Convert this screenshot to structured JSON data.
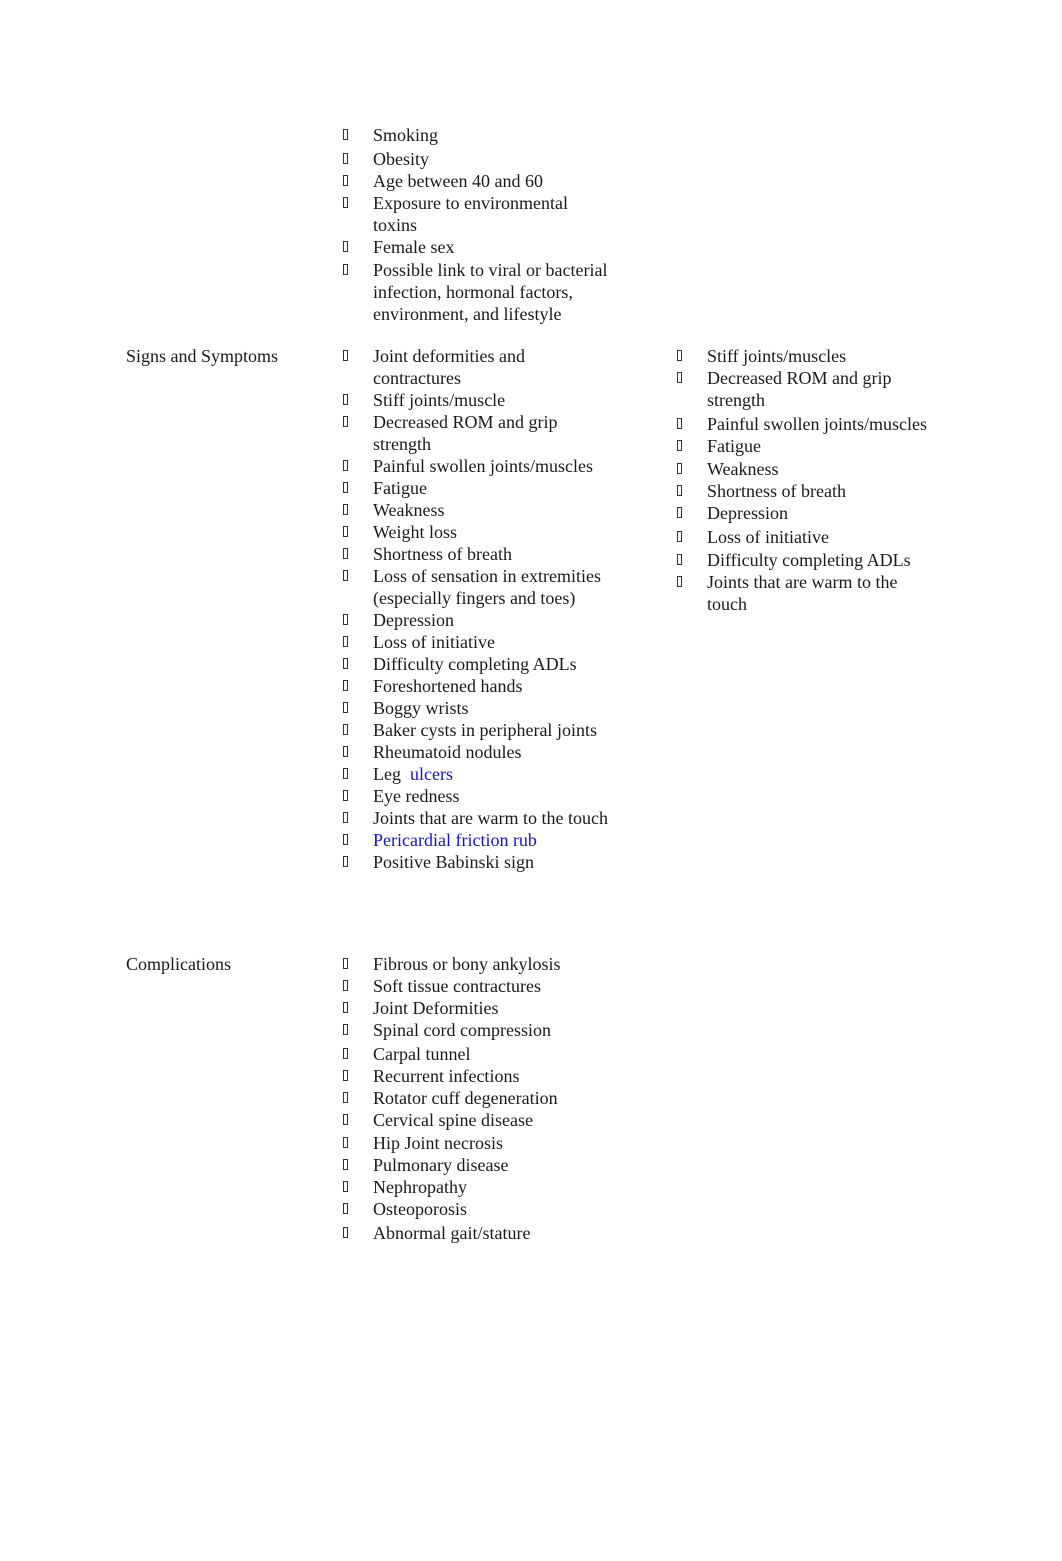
{
  "risk_factors": {
    "label": "",
    "items": [
      {
        "text": "Smoking"
      },
      {
        "text": "Obesity"
      },
      {
        "text": "Age between 40 and 60"
      },
      {
        "text": "Exposure to environmental toxins"
      },
      {
        "text": "Female sex"
      },
      {
        "text": "Possible link to viral or bacterial infection, hormonal factors, environment, and lifestyle"
      }
    ]
  },
  "signs_and_symptoms": {
    "label": "Signs and Symptoms",
    "items": [
      {
        "text": "Joint deformities and contractures"
      },
      {
        "text": "Stiff joints/muscle"
      },
      {
        "text": "Decreased ROM and grip strength"
      },
      {
        "text": "Painful swollen joints/muscles"
      },
      {
        "text": "Fatigue"
      },
      {
        "text": "Weakness"
      },
      {
        "text": "Weight loss"
      },
      {
        "text": "Shortness of breath"
      },
      {
        "text": "Loss of sensation in extremities (especially fingers and toes)"
      },
      {
        "text": "Depression"
      },
      {
        "text": "Loss of initiative"
      },
      {
        "text": "Difficulty completing ADLs"
      },
      {
        "text": "Foreshortened hands"
      },
      {
        "text": "Boggy wrists"
      },
      {
        "text": "Baker cysts in peripheral joints"
      },
      {
        "text": "Rheumatoid nodules"
      },
      {
        "text": "Leg",
        "link": "ulcers"
      },
      {
        "text": "Eye redness"
      },
      {
        "text": "Joints that are warm to the touch"
      },
      {
        "text": "",
        "link": "Pericardial friction rub"
      },
      {
        "text": "Positive Babinski sign"
      }
    ],
    "patient_items": [
      {
        "text": "Stiff joints/muscles"
      },
      {
        "text": "Decreased ROM and grip strength"
      },
      {
        "text": "Painful swollen joints/muscles"
      },
      {
        "text": "Fatigue"
      },
      {
        "text": "Weakness"
      },
      {
        "text": "Shortness of breath"
      },
      {
        "text": "Depression"
      },
      {
        "text": "Loss of initiative"
      },
      {
        "text": "Difficulty completing ADLs"
      },
      {
        "text": "Joints that are warm to the touch"
      }
    ]
  },
  "complications": {
    "label": "Complications",
    "items": [
      {
        "text": "Fibrous or bony ankylosis"
      },
      {
        "text": "Soft tissue contractures"
      },
      {
        "text": "Joint Deformities"
      },
      {
        "text": "Spinal cord compression"
      },
      {
        "text": "Carpal tunnel"
      },
      {
        "text": "Recurrent infections"
      },
      {
        "text": "Rotator cuff degeneration"
      },
      {
        "text": "Cervical spine disease"
      },
      {
        "text": "Hip Joint necrosis"
      },
      {
        "text": "Pulmonary disease"
      },
      {
        "text": "Nephropathy"
      },
      {
        "text": "Osteoporosis"
      },
      {
        "text": "Abnormal gait/stature"
      }
    ]
  },
  "colors": {
    "text": "#1a1a1a",
    "link": "#1010e8"
  }
}
